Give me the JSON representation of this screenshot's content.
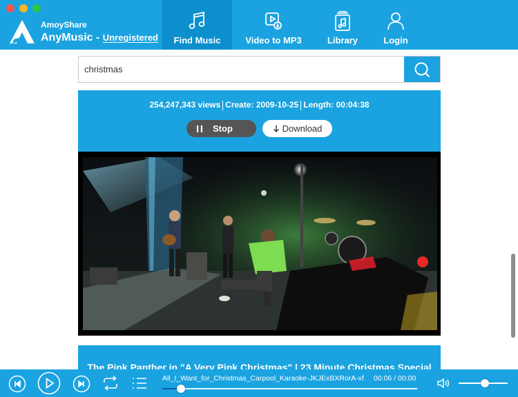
{
  "app": {
    "brand_small": "AmoyShare",
    "brand_name": "AnyMusic",
    "brand_dash": " - ",
    "registration": "Unregistered"
  },
  "nav": {
    "find_music": "Find Music",
    "video_to_mp3": "Video to MP3",
    "library": "Library",
    "login": "Login",
    "active": "find_music"
  },
  "search": {
    "value": "christmas"
  },
  "result": {
    "views": "254,247,343 views",
    "created": "Create: 2009-10-25",
    "length": "Length: 00:04:38",
    "stop_label": "Stop",
    "download_label": "Download"
  },
  "next_result": {
    "title": "The Pink Panther in \"A Very Pink Christmas\" | 23 Minute Christmas Special"
  },
  "player": {
    "track_name": "All_I_Want_for_Christmas_Carpool_Karaoke-JKJExBXRorA-xf",
    "time": "00:06 / 00:00",
    "progress_fraction": 0.06,
    "volume_fraction": 0.5
  },
  "colors": {
    "accent": "#1aa3e0",
    "active_tab": "#0c8fcc",
    "stop_button": "#555555"
  },
  "icons": {
    "nav": [
      "music-note-icon",
      "video-play-icon",
      "library-icon",
      "user-icon"
    ],
    "player": [
      "previous-icon",
      "play-icon",
      "next-icon",
      "repeat-icon",
      "playlist-icon",
      "volume-icon"
    ]
  }
}
